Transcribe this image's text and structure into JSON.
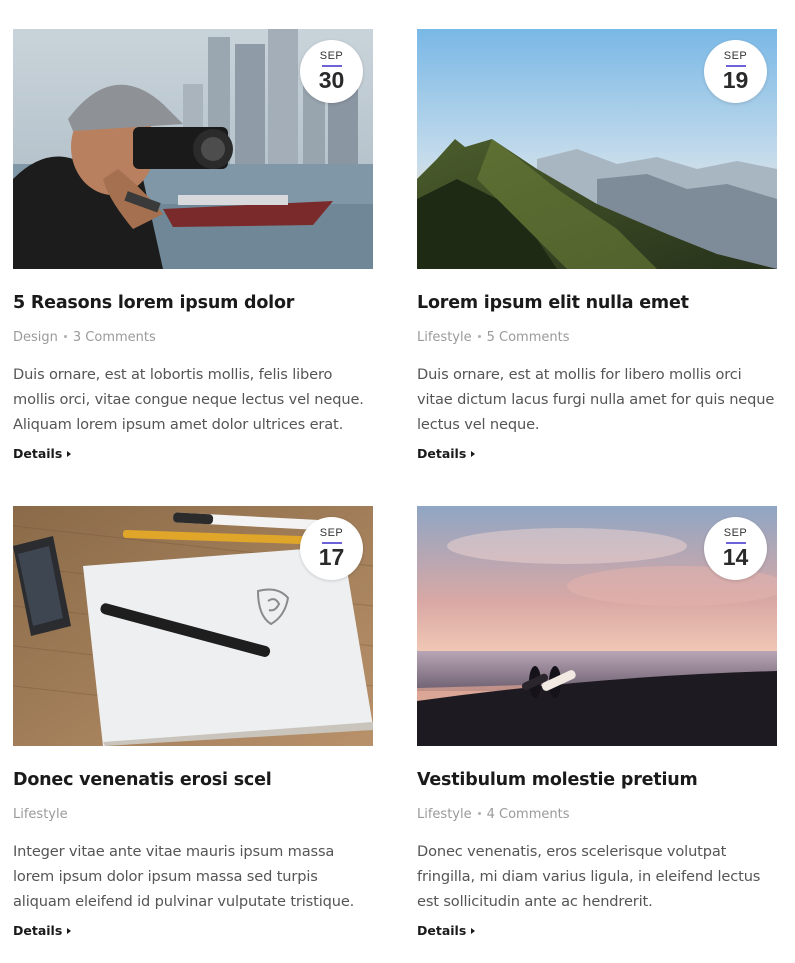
{
  "posts": [
    {
      "image": "photographer-with-camera-image",
      "month": "SEP",
      "day": "30",
      "title": "5 Reasons lorem ipsum dolor",
      "category": "Design",
      "comments": "3 Comments",
      "excerpt": "Duis ornare, est at lobortis mollis, felis libero mollis orci, vitae congue neque lectus vel neque. Aliquam lorem ipsum amet dolor ultrices erat.",
      "details_label": "Details"
    },
    {
      "image": "mountain-ridge-image",
      "month": "SEP",
      "day": "19",
      "title": "Lorem ipsum elit nulla emet",
      "category": "Lifestyle",
      "comments": "5 Comments",
      "excerpt": "Duis ornare, est at mollis for libero mollis orci vitae dictum lacus furgi nulla amet for quis neque lectus vel neque.",
      "details_label": "Details"
    },
    {
      "image": "notebook-and-pens-image",
      "month": "SEP",
      "day": "17",
      "title": "Donec venenatis erosi scel",
      "category": "Lifestyle",
      "comments": "",
      "excerpt": "Integer vitae ante vitae mauris ipsum massa lorem ipsum dolor ipsum massa sed turpis aliquam eleifend id pulvinar vulputate tristique.",
      "details_label": "Details"
    },
    {
      "image": "surfers-beach-sunset-image",
      "month": "SEP",
      "day": "14",
      "title": "Vestibulum molestie pretium",
      "category": "Lifestyle",
      "comments": "4 Comments",
      "excerpt": "Donec venenatis, eros scelerisque volutpat fringilla, mi diam varius ligula, in eleifend lectus est sollicitudin ante ac hendrerit.",
      "details_label": "Details"
    }
  ],
  "colors": {
    "accent": "#6c63d9",
    "title": "#1a1a1a",
    "meta": "#9a9a9a",
    "text": "#555555"
  }
}
